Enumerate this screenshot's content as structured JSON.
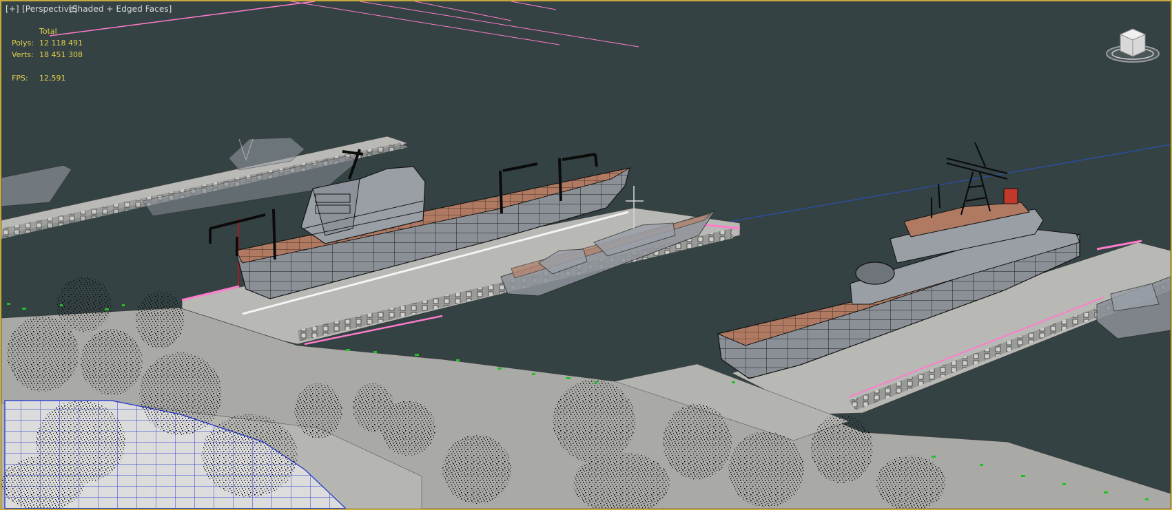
{
  "viewport": {
    "plus_label": "[+]",
    "view_label": "[Perspective]",
    "shading_label": "[Shaded + Edged Faces]"
  },
  "stats": {
    "header": "Total",
    "polys_label": "Polys:",
    "polys_value": "12 118 491",
    "verts_label": "Verts:",
    "verts_value": "18 451 308",
    "fps_label": "FPS:",
    "fps_value": "12,591"
  },
  "colors": {
    "frame": "#c8aa3c",
    "water": "#344244",
    "stats_text": "#e3d24a",
    "hull": "#8b9097",
    "deck": "#b07a62",
    "pier": "#b9bab6",
    "selection": "#ff7ccc",
    "axis_blue": "#2b4fb0"
  },
  "viewcube": {
    "icon": "viewcube-icon"
  }
}
